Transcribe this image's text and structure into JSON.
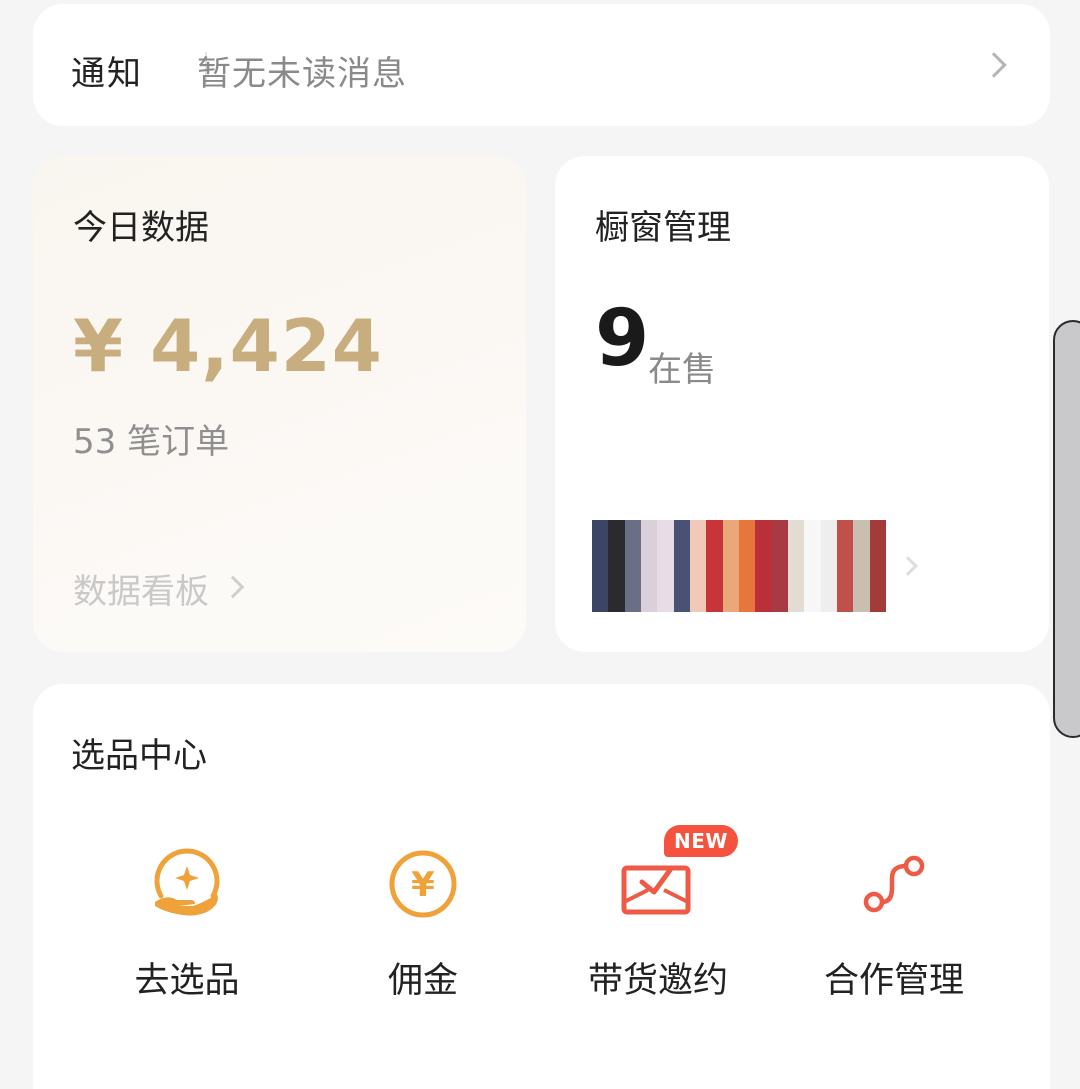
{
  "notice": {
    "title": "通知",
    "message": "暂无未读消息"
  },
  "today": {
    "title": "今日数据",
    "amount": "¥ 4,424",
    "orders": "53 笔订单",
    "link": "数据看板"
  },
  "showcase": {
    "title": "橱窗管理",
    "count": "9",
    "count_label": "在售"
  },
  "selection": {
    "title": "选品中心",
    "actions": [
      {
        "label": "去选品",
        "icon": "hand-star-icon"
      },
      {
        "label": "佣金",
        "icon": "yuan-coin-icon"
      },
      {
        "label": "带货邀约",
        "icon": "envelope-check-icon",
        "badge": "NEW"
      },
      {
        "label": "合作管理",
        "icon": "route-icon"
      }
    ]
  },
  "colors": {
    "accent_orange": "#f0a23a",
    "accent_red": "#ee5a46",
    "amount_gold": "#c8ad7f"
  }
}
